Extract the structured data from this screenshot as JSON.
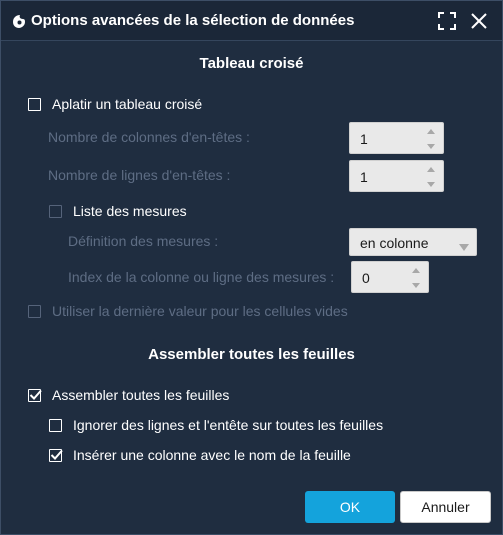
{
  "window": {
    "title": "Options avancées de la sélection de données",
    "icon": "app-logo-icon",
    "maximize_icon": "expand-corners-icon",
    "close_icon": "close-icon"
  },
  "pivot": {
    "section_title": "Tableau croisé",
    "flatten_label": "Aplatir un tableau croisé",
    "flatten_checked": false,
    "header_columns_label": "Nombre de colonnes d'en-têtes :",
    "header_columns_value": "1",
    "header_rows_label": "Nombre de lignes d'en-têtes :",
    "header_rows_value": "1",
    "measures_list_label": "Liste des mesures",
    "measures_list_checked": false,
    "measures_definition_label": "Définition des mesures :",
    "measures_definition_value": "en colonne",
    "measures_index_label": "Index de la colonne ou ligne des mesures :",
    "measures_index_value": "0",
    "use_last_value_label": "Utiliser la dernière valeur pour les cellules vides",
    "use_last_value_checked": false
  },
  "sheets": {
    "section_title": "Assembler toutes les feuilles",
    "assemble_label": "Assembler toutes les feuilles",
    "assemble_checked": true,
    "ignore_rows_label": "Ignorer des lignes et l'entête sur toutes les feuilles",
    "ignore_rows_checked": false,
    "insert_column_label": "Insérer une colonne avec le nom de la feuille",
    "insert_column_checked": true
  },
  "buttons": {
    "ok_label": "OK",
    "cancel_label": "Annuler"
  },
  "colors": {
    "background": "#1f2d40",
    "titlebar": "#1b2738",
    "accent": "#14a3dc",
    "disabled_text": "#5e6d84"
  }
}
